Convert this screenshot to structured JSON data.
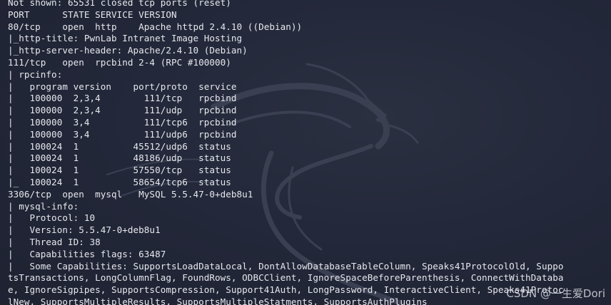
{
  "terminal": {
    "lines": [
      "Not shown: 65531 closed tcp ports (reset)",
      "PORT      STATE SERVICE VERSION",
      "80/tcp    open  http    Apache httpd 2.4.10 ((Debian))",
      "|_http-title: PwnLab Intranet Image Hosting",
      "|_http-server-header: Apache/2.4.10 (Debian)",
      "111/tcp   open  rpcbind 2-4 (RPC #100000)",
      "| rpcinfo:",
      "|   program version    port/proto  service",
      "|   100000  2,3,4        111/tcp   rpcbind",
      "|   100000  2,3,4        111/udp   rpcbind",
      "|   100000  3,4          111/tcp6  rpcbind",
      "|   100000  3,4          111/udp6  rpcbind",
      "|   100024  1          45512/udp6  status",
      "|   100024  1          48186/udp   status",
      "|   100024  1          57550/tcp   status",
      "|_  100024  1          58654/tcp6  status",
      "3306/tcp  open  mysql   MySQL 5.5.47-0+deb8u1",
      "| mysql-info:",
      "|   Protocol: 10",
      "|   Version: 5.5.47-0+deb8u1",
      "|   Thread ID: 38",
      "|   Capabilities flags: 63487",
      "|   Some Capabilities: SupportsLoadDataLocal, DontAllowDatabaseTableColumn, Speaks41ProtocolOld, Suppo",
      "tsTransactions, LongColumnFlag, FoundRows, ODBCClient, IgnoreSpaceBeforeParenthesis, ConnectWithDataba",
      "e, IgnoreSigpipes, SupportsCompression, Support41Auth, LongPassword, InteractiveClient, Speaks41Protoc",
      "lNew, SupportsMultipleResults, SupportsMultipleStatments, SupportsAuthPlugins"
    ]
  },
  "watermark": {
    "text": "CSDN @一生爱Dori"
  },
  "colors": {
    "background": "#222633",
    "text": "#e7e8ee",
    "logo": "#3a4052"
  },
  "icons": {
    "background_logo": "kali-dragon-icon"
  }
}
